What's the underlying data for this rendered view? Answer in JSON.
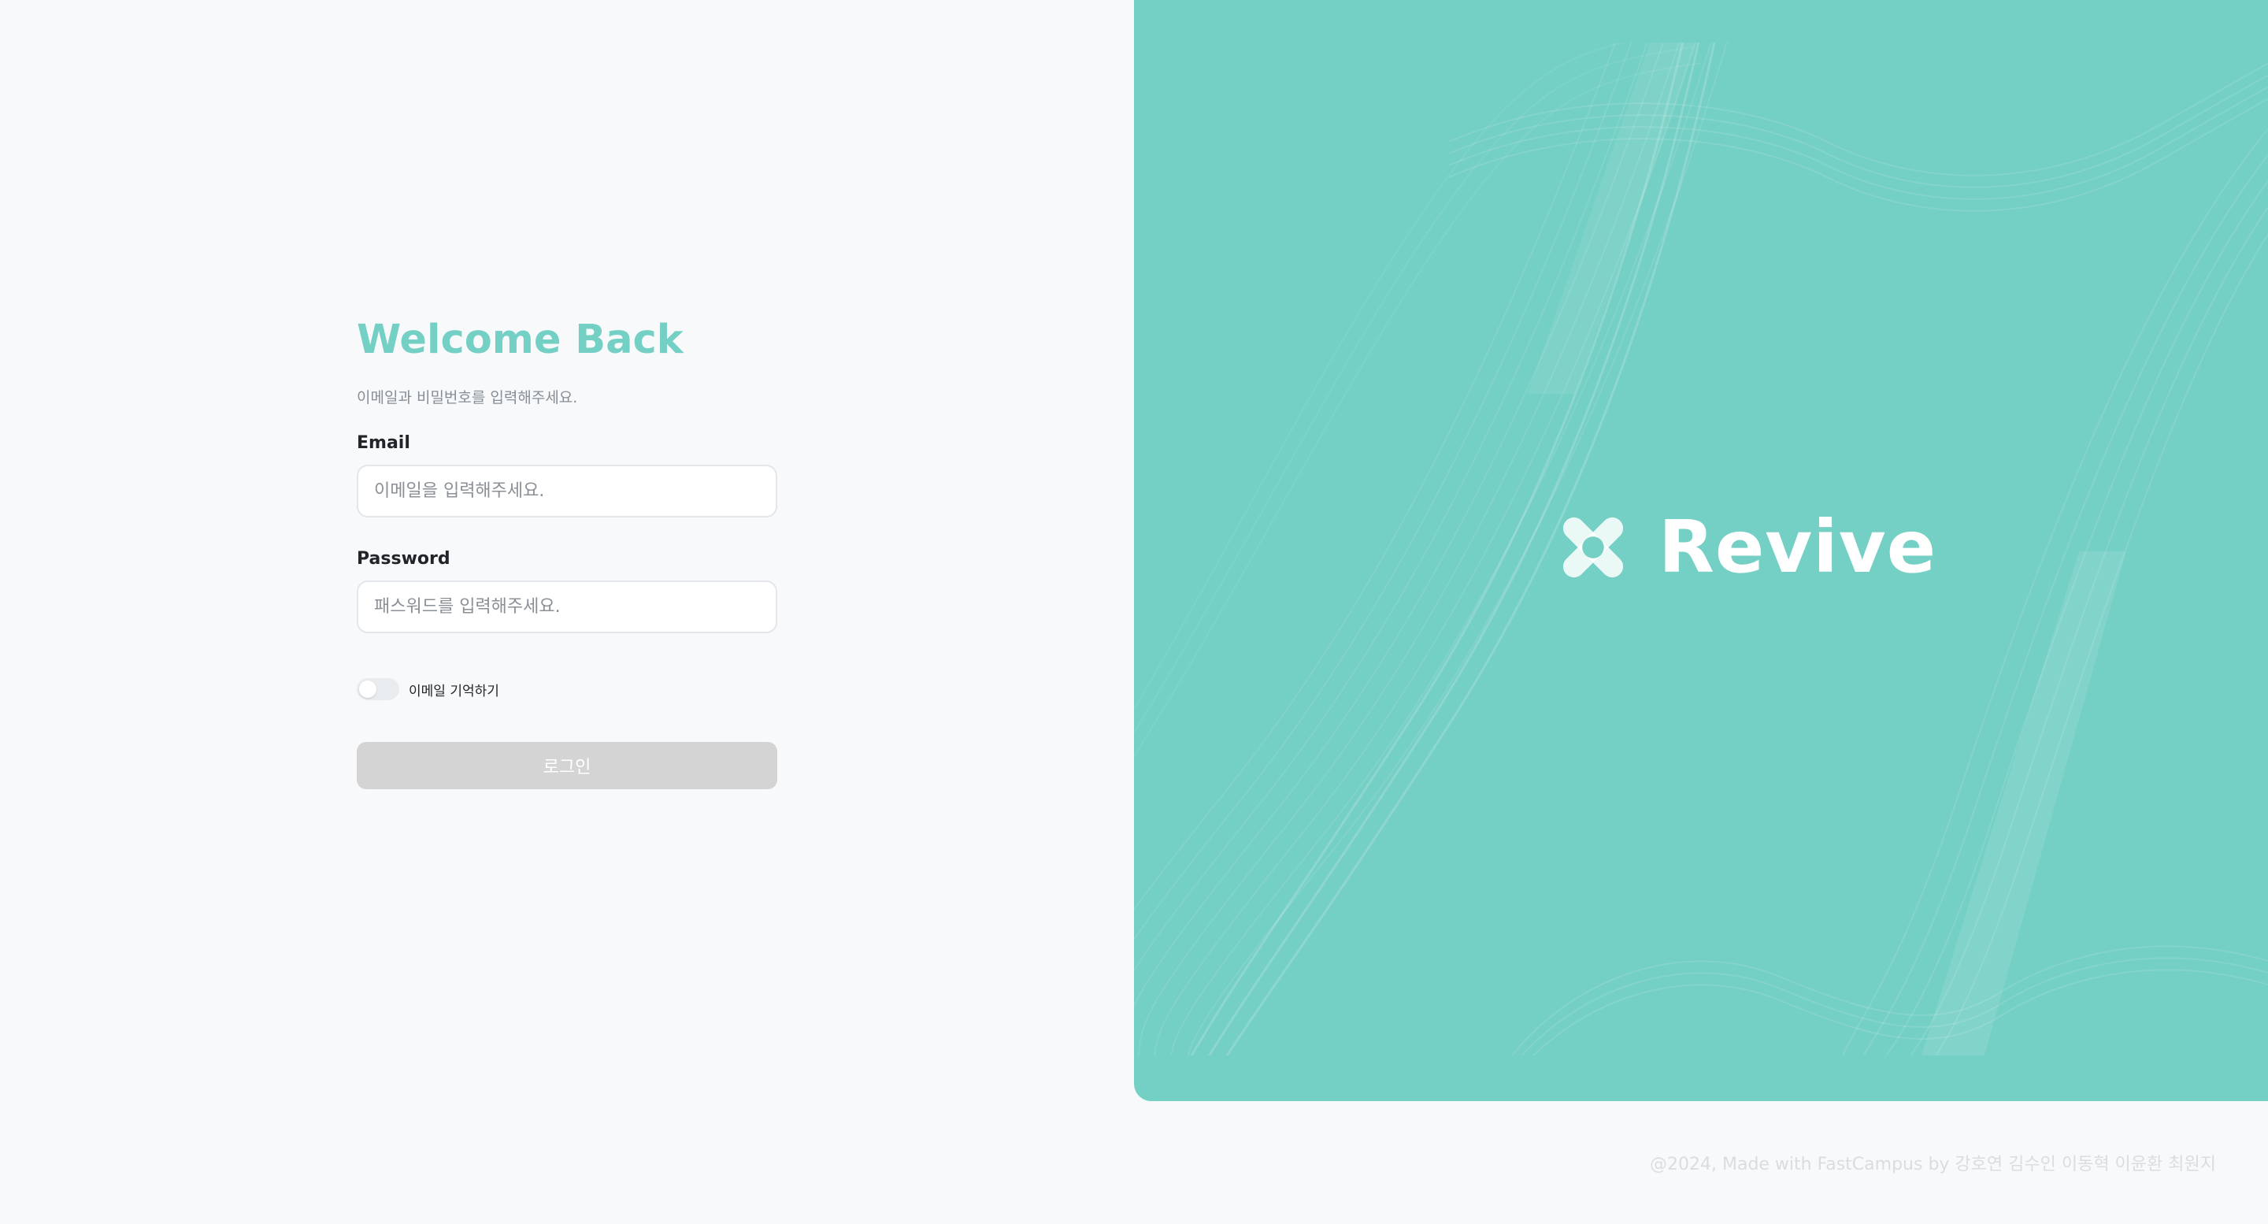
{
  "login": {
    "title": "Welcome Back",
    "subtitle": "이메일과 비밀번호를 입력해주세요.",
    "email": {
      "label": "Email",
      "value": "",
      "placeholder": "이메일을 입력해주세요."
    },
    "password": {
      "label": "Password",
      "value": "",
      "placeholder": "패스워드를 입력해주세요."
    },
    "remember": {
      "label": "이메일 기억하기",
      "checked": false
    },
    "submit_label": "로그인",
    "submit_enabled": false
  },
  "brand": {
    "name": "Revive",
    "logo_icon": "cross-x-logo-icon",
    "background_color": "#74cfc4",
    "accent_color": "#74cfc4"
  },
  "footer": {
    "text": "@2024, Made with FastCampus by 강호연 김수인 이동혁 이윤환 최원지"
  }
}
